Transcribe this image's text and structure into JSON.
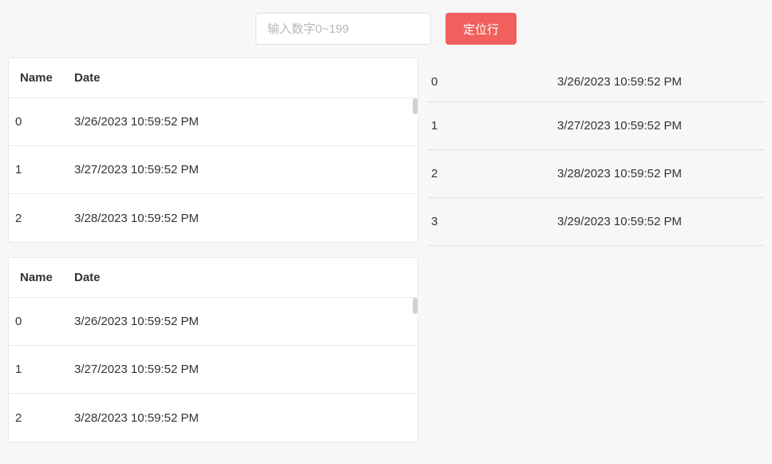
{
  "topbar": {
    "input_placeholder": "输入数字0~199",
    "input_value": "",
    "button_label": "定位行"
  },
  "columns": {
    "name": "Name",
    "date": "Date"
  },
  "tableA": {
    "rows": [
      {
        "name": "0",
        "date": "3/26/2023 10:59:52 PM"
      },
      {
        "name": "1",
        "date": "3/27/2023 10:59:52 PM"
      },
      {
        "name": "2",
        "date": "3/28/2023 10:59:52 PM"
      }
    ]
  },
  "tableB": {
    "rows": [
      {
        "name": "0",
        "date": "3/26/2023 10:59:52 PM"
      },
      {
        "name": "1",
        "date": "3/27/2023 10:59:52 PM"
      },
      {
        "name": "2",
        "date": "3/28/2023 10:59:52 PM"
      }
    ]
  },
  "tableC": {
    "rows": [
      {
        "name": "0",
        "date": "3/26/2023 10:59:52 PM"
      },
      {
        "name": "1",
        "date": "3/27/2023 10:59:52 PM"
      },
      {
        "name": "2",
        "date": "3/28/2023 10:59:52 PM"
      },
      {
        "name": "3",
        "date": "3/29/2023 10:59:52 PM"
      }
    ]
  }
}
